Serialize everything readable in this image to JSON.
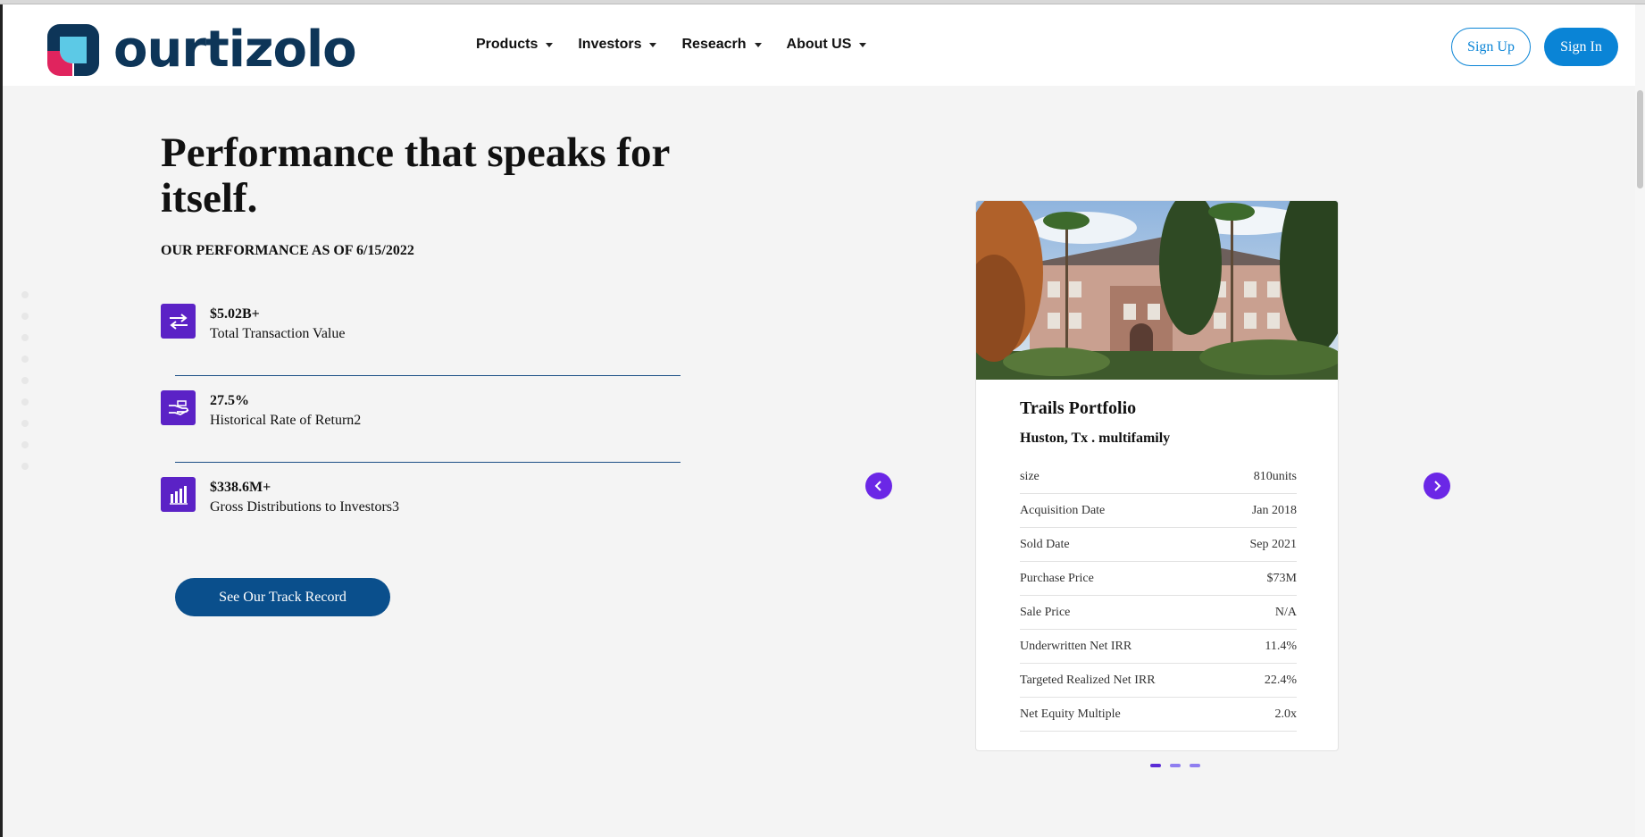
{
  "brand": {
    "name": "ourtizolo"
  },
  "nav": [
    {
      "label": "Products"
    },
    {
      "label": "Investors"
    },
    {
      "label": "Reseacrh"
    },
    {
      "label": "About US"
    }
  ],
  "auth": {
    "signup_label": "Sign Up",
    "signin_label": "Sign In"
  },
  "hero": {
    "title": "Performance that speaks for itself.",
    "subtitle": "OUR PERFORMANCE AS OF 6/15/2022",
    "cta_label": "See Our Track Record"
  },
  "stats": [
    {
      "value": "$5.02B+",
      "label": "Total Transaction Value",
      "icon": "transfer-arrows-icon"
    },
    {
      "value": "27.5%",
      "label": "Historical Rate of Return2",
      "icon": "hand-money-icon"
    },
    {
      "value": "$338.6M+",
      "label": "Gross Distributions to Investors3",
      "icon": "bar-chart-icon"
    }
  ],
  "card": {
    "title": "Trails Portfolio",
    "location": "Huston, Tx . multifamily",
    "rows": [
      {
        "label": "size",
        "value": "810units"
      },
      {
        "label": "Acquisition Date",
        "value": "Jan 2018"
      },
      {
        "label": "Sold Date",
        "value": "Sep 2021"
      },
      {
        "label": "Purchase Price",
        "value": "$73M"
      },
      {
        "label": "Sale Price",
        "value": "N/A"
      },
      {
        "label": "Underwritten Net IRR",
        "value": "11.4%"
      },
      {
        "label": "Targeted Realized Net IRR",
        "value": "22.4%"
      },
      {
        "label": "Net Equity Multiple",
        "value": "2.0x"
      }
    ]
  },
  "carousel": {
    "slide_count": 3,
    "active_slide": 1
  },
  "colors": {
    "brand_navy": "#0d3558",
    "accent_blue": "#0a84d6",
    "accent_purple": "#5b22c6",
    "cta_blue": "#0a4f8c"
  }
}
